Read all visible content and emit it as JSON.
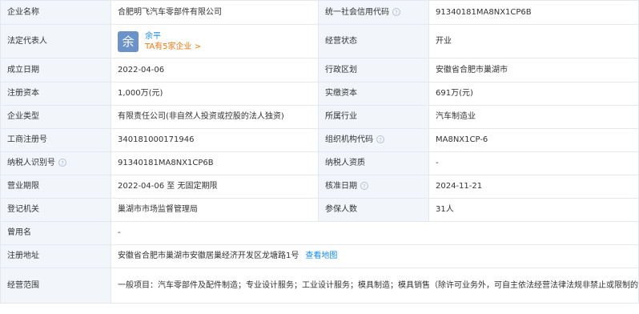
{
  "company": {
    "name_label": "企业名称",
    "name_value": "合肥明飞汽车零部件有限公司",
    "credit_code_label": "统一社会信用代码",
    "credit_code_value": "91340181MA8NX1CP6B",
    "legal_rep_label": "法定代表人",
    "legal_rep_avatar_char": "余",
    "legal_rep_name": "余平",
    "legal_rep_companies": "TA有5家企业 >",
    "status_label": "经营状态",
    "status_value": "开业",
    "founded_label": "成立日期",
    "founded_value": "2022-04-06",
    "region_label": "行政区划",
    "region_value": "安徽省合肥市巢湖市",
    "reg_capital_label": "注册资本",
    "reg_capital_value": "1,000万(元)",
    "paid_capital_label": "实缴资本",
    "paid_capital_value": "691万(元)",
    "type_label": "企业类型",
    "type_value": "有限责任公司(非自然人投资或控股的法人独资)",
    "industry_label": "所属行业",
    "industry_value": "汽车制造业",
    "biz_reg_no_label": "工商注册号",
    "biz_reg_no_value": "340181000171946",
    "org_code_label": "组织机构代码",
    "org_code_value": "MA8NX1CP-6",
    "taxpayer_id_label": "纳税人识别号",
    "taxpayer_id_value": "91340181MA8NX1CP6B",
    "taxpayer_qual_label": "纳税人资质",
    "taxpayer_qual_value": "-",
    "term_label": "营业期限",
    "term_value": "2022-04-06 至 无固定期限",
    "approved_label": "核准日期",
    "approved_value": "2024-11-21",
    "authority_label": "登记机关",
    "authority_value": "巢湖市市场监督管理局",
    "insured_label": "参保人数",
    "insured_value": "31人",
    "former_name_label": "曾用名",
    "former_name_value": "-",
    "address_label": "注册地址",
    "address_value": "安徽省合肥市巢湖市安徽居巢经济开发区龙塘路1号",
    "address_map_link": "查看地图",
    "scope_label": "经营范围",
    "scope_value": "一般项目：汽车零部件及配件制造；专业设计服务；工业设计服务；模具制造；模具销售（除许可业务外，可自主依法经营法律法规非禁止或限制的项目）"
  },
  "icons": {
    "help": "question-circle-icon"
  },
  "colors": {
    "label_bg": "#f2f6fb",
    "border": "#e4e8ef",
    "link": "#128bed",
    "orange": "#f0770e",
    "avatar": "#6b93c9"
  }
}
